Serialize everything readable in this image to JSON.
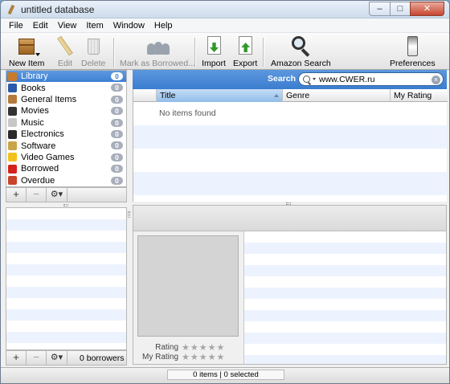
{
  "window": {
    "title": "untitled database"
  },
  "menu": [
    "File",
    "Edit",
    "View",
    "Item",
    "Window",
    "Help"
  ],
  "toolbar": {
    "new_item": "New Item",
    "edit": "Edit",
    "delete": "Delete",
    "mark_borrowed": "Mark as Borrowed...",
    "import": "Import",
    "export": "Export",
    "amazon_search": "Amazon Search",
    "preferences": "Preferences"
  },
  "sources": [
    {
      "label": "Library",
      "count": "0",
      "icon": "library-icon",
      "color": "#c97a2a"
    },
    {
      "label": "Books",
      "count": "0",
      "icon": "books-icon",
      "color": "#2b5aa8"
    },
    {
      "label": "General Items",
      "count": "0",
      "icon": "box-icon",
      "color": "#b47a3c"
    },
    {
      "label": "Movies",
      "count": "0",
      "icon": "clapperboard-icon",
      "color": "#333333"
    },
    {
      "label": "Music",
      "count": "0",
      "icon": "cd-icon",
      "color": "#c8c8c8"
    },
    {
      "label": "Electronics",
      "count": "0",
      "icon": "electronics-icon",
      "color": "#2a2a2a"
    },
    {
      "label": "Software",
      "count": "0",
      "icon": "software-icon",
      "color": "#c9a44a"
    },
    {
      "label": "Video Games",
      "count": "0",
      "icon": "smiley-icon",
      "color": "#f2c21c"
    },
    {
      "label": "Borrowed",
      "count": "0",
      "icon": "no-entry-icon",
      "color": "#d4231c"
    },
    {
      "label": "Overdue",
      "count": "0",
      "icon": "calendar-icon",
      "color": "#c8442a"
    }
  ],
  "source_controls": {
    "add": "+",
    "remove": "−",
    "gear": "⚙▾"
  },
  "search": {
    "label": "Search",
    "value": "www.CWER.ru"
  },
  "table": {
    "columns": [
      "Title",
      "Genre",
      "My Rating"
    ],
    "empty_message": "No items found"
  },
  "detail": {
    "rating_label": "Rating",
    "my_rating_label": "My Rating",
    "stars": "★★★★★"
  },
  "borrowers": {
    "count_text": "0 borrowers"
  },
  "status": {
    "text": "0 items | 0 selected"
  }
}
